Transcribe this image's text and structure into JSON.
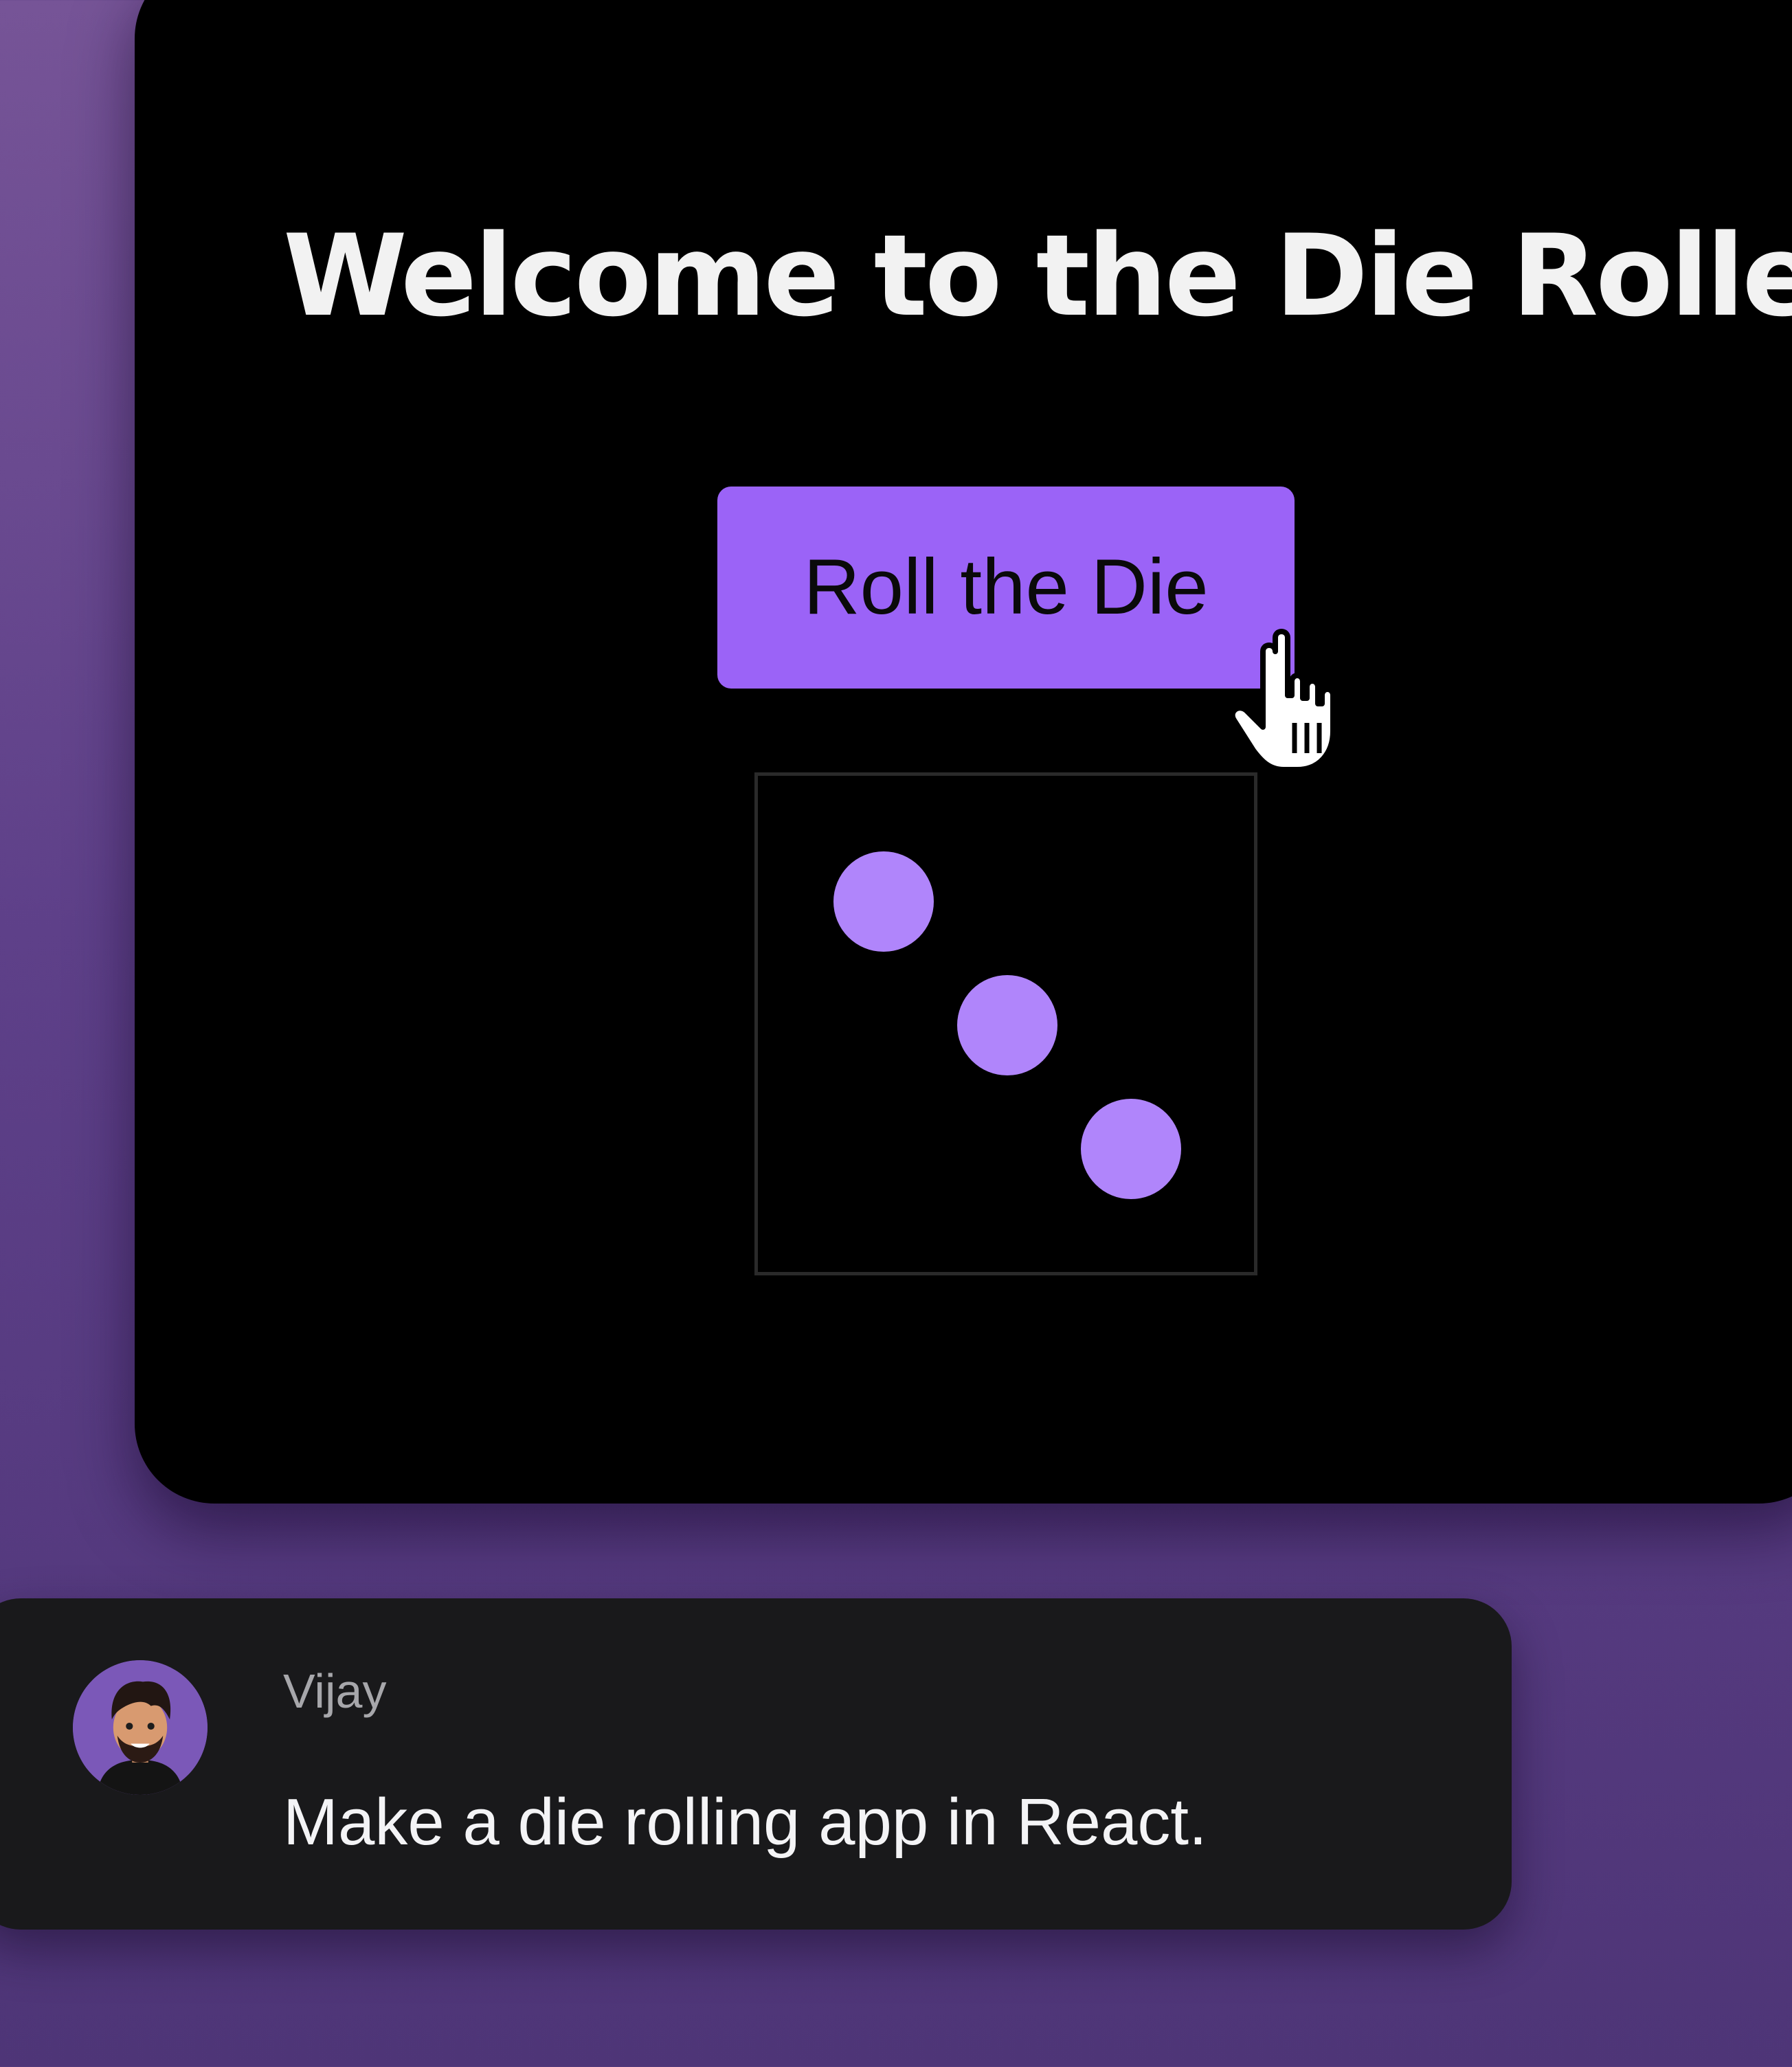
{
  "app": {
    "title": "Welcome to the Die Roller",
    "roll_button_label": "Roll the Die",
    "die": {
      "value": 3,
      "pip_color": "#b085fb"
    },
    "accent_color": "#9b63f7"
  },
  "chat": {
    "author": "Vijay",
    "message": "Make a die rolling app in React.",
    "avatar_icon": "user-avatar-icon"
  },
  "cursor_icon": "hand-pointer-icon"
}
